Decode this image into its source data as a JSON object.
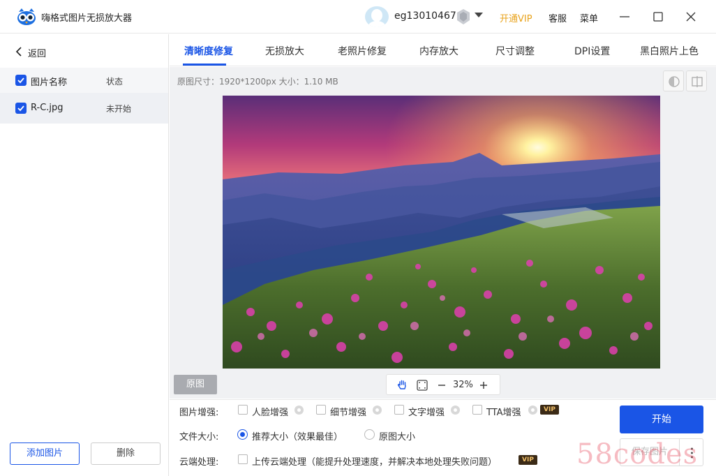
{
  "app": {
    "title": "嗨格式图片无损放大器"
  },
  "user": {
    "name": "eg13010467"
  },
  "header": {
    "vip_label": "开通VIP",
    "service_label": "客服",
    "menu_label": "菜单"
  },
  "sidebar": {
    "back_label": "返回",
    "columns": {
      "name": "图片名称",
      "status": "状态"
    },
    "files": [
      {
        "name": "R-C.jpg",
        "status": "未开始",
        "checked": true
      }
    ],
    "add_label": "添加图片",
    "delete_label": "删除"
  },
  "tabs": [
    {
      "label": "清晰度修复",
      "active": true
    },
    {
      "label": "无损放大"
    },
    {
      "label": "老照片修复"
    },
    {
      "label": "内存放大"
    },
    {
      "label": "尺寸调整"
    },
    {
      "label": "DPI设置"
    },
    {
      "label": "黑白照片上色"
    }
  ],
  "preview": {
    "info": "原图尺寸：1920*1200px   大小：1.10 MB",
    "original_label": "原图",
    "zoom": "32%"
  },
  "options": {
    "enhance_label": "图片增强:",
    "enhance_items": [
      "人脸增强",
      "细节增强",
      "文字增强",
      "TTA增强"
    ],
    "vip_tag": "VIP",
    "size_label": "文件大小:",
    "size_options": [
      "推荐大小（效果最佳）",
      "原图大小"
    ],
    "cloud_label": "云端处理:",
    "cloud_option": "上传云端处理（能提升处理速度，并解决本地处理失败问题）"
  },
  "actions": {
    "start_label": "开始",
    "save_label": "保存图片"
  },
  "watermark": "58codes",
  "colors": {
    "accent": "#1a55e6",
    "vip": "#e8a21a"
  }
}
